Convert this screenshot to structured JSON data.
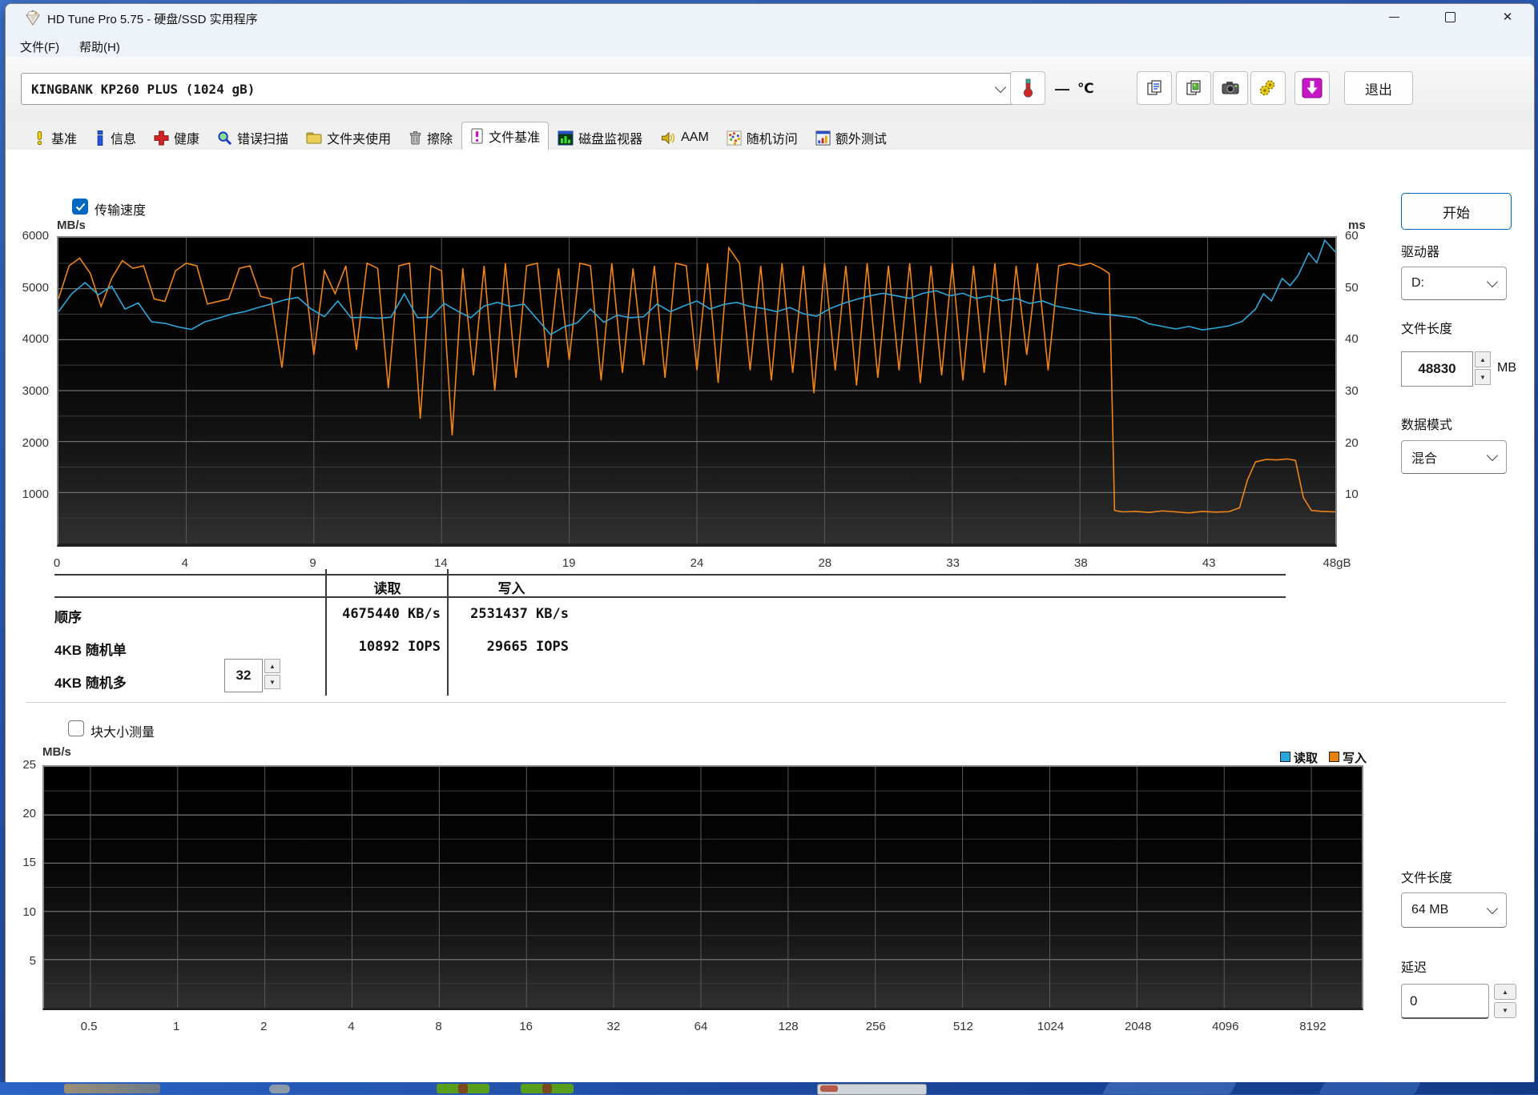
{
  "colors": {
    "accent": "#0067c0",
    "read": "#2fa8dc",
    "write": "#f08418",
    "legend_read": "#29a8e0",
    "legend_write": "#e8820c"
  },
  "window": {
    "title": "HD Tune Pro 5.75 - 硬盘/SSD 实用程序",
    "controls": {
      "close": "✕"
    }
  },
  "menu": {
    "file": "文件(F)",
    "help": "帮助(H)"
  },
  "toolbar": {
    "drive_select": "KINGBANK KP260 PLUS (1024 gB)",
    "temperature_value": "—",
    "temperature_unit": "℃",
    "exit_label": "退出"
  },
  "tabs": [
    {
      "label": "基准"
    },
    {
      "label": "信息"
    },
    {
      "label": "健康"
    },
    {
      "label": "错误扫描"
    },
    {
      "label": "文件夹使用"
    },
    {
      "label": "擦除"
    },
    {
      "label": "文件基准",
      "active": true
    },
    {
      "label": "磁盘监视器"
    },
    {
      "label": "AAM"
    },
    {
      "label": "随机访问"
    },
    {
      "label": "额外测试"
    }
  ],
  "benchmark": {
    "transfer_label": "传输速度",
    "start": "开始",
    "drive_label": "驱动器",
    "drive_value": "D:",
    "file_length_label": "文件长度",
    "file_length_value": "48830",
    "file_length_unit": "MB",
    "data_mode_label": "数据模式",
    "data_mode_value": "混合",
    "queue_depth": "32"
  },
  "results": {
    "read_header": "读取",
    "write_header": "写入",
    "rows": [
      {
        "label": "顺序",
        "read": "4675440 KB/s",
        "write": "2531437 KB/s"
      },
      {
        "label": "4KB 随机单",
        "read": "10892 IOPS",
        "write": "29665 IOPS"
      },
      {
        "label": "4KB 随机多",
        "read": "",
        "write": ""
      }
    ]
  },
  "block": {
    "checkbox_label": "块大小测量",
    "legend_read": "读取",
    "legend_write": "写入",
    "file_length_label": "文件长度",
    "file_length_value": "64 MB",
    "delay_label": "延迟",
    "delay_value": "0"
  },
  "chart_data": [
    {
      "type": "line",
      "title": "传输速度",
      "x_axis": {
        "min": 0,
        "max": 48,
        "unit": "GB",
        "tick_labels": [
          "0",
          "4",
          "9",
          "14",
          "19",
          "24",
          "28",
          "33",
          "38",
          "43",
          "48gB"
        ]
      },
      "y_axis_left": {
        "label": "MB/s",
        "min": 0,
        "max": 6000,
        "tick_labels": [
          "6000",
          "5000",
          "4000",
          "3000",
          "2000",
          "1000"
        ]
      },
      "y_axis_right": {
        "label": "ms",
        "min": 0,
        "max": 60,
        "tick_labels": [
          "60",
          "50",
          "40",
          "30",
          "20",
          "10"
        ]
      },
      "grid": {
        "h_major": 1000,
        "h_minor": 500,
        "v_at_each_tick": true
      },
      "series": [
        {
          "name": "读取",
          "color": "#2fa8dc",
          "points": [
            [
              0,
              4550
            ],
            [
              0.5,
              4900
            ],
            [
              1,
              5120
            ],
            [
              1.5,
              4880
            ],
            [
              2,
              5050
            ],
            [
              2.5,
              4600
            ],
            [
              3,
              4720
            ],
            [
              3.5,
              4350
            ],
            [
              4,
              4320
            ],
            [
              4.5,
              4250
            ],
            [
              5,
              4200
            ],
            [
              5.5,
              4350
            ],
            [
              6,
              4420
            ],
            [
              6.5,
              4500
            ],
            [
              7,
              4550
            ],
            [
              7.5,
              4630
            ],
            [
              8,
              4700
            ],
            [
              8.5,
              4780
            ],
            [
              9,
              4830
            ],
            [
              9.5,
              4600
            ],
            [
              10,
              4450
            ],
            [
              10.5,
              4760
            ],
            [
              11,
              4430
            ],
            [
              11.5,
              4440
            ],
            [
              12,
              4420
            ],
            [
              12.5,
              4440
            ],
            [
              13,
              4900
            ],
            [
              13.5,
              4430
            ],
            [
              14,
              4440
            ],
            [
              14.5,
              4710
            ],
            [
              15,
              4560
            ],
            [
              15.5,
              4430
            ],
            [
              16,
              4660
            ],
            [
              16.5,
              4730
            ],
            [
              17,
              4650
            ],
            [
              17.5,
              4700
            ],
            [
              18,
              4400
            ],
            [
              18.5,
              4100
            ],
            [
              19,
              4250
            ],
            [
              19.5,
              4330
            ],
            [
              20,
              4600
            ],
            [
              20.5,
              4340
            ],
            [
              21,
              4480
            ],
            [
              21.5,
              4430
            ],
            [
              22,
              4450
            ],
            [
              22.5,
              4700
            ],
            [
              23,
              4550
            ],
            [
              23.5,
              4660
            ],
            [
              24,
              4760
            ],
            [
              24.5,
              4600
            ],
            [
              25,
              4690
            ],
            [
              25.5,
              4730
            ],
            [
              26,
              4650
            ],
            [
              26.5,
              4610
            ],
            [
              27,
              4550
            ],
            [
              27.5,
              4630
            ],
            [
              28,
              4510
            ],
            [
              28.5,
              4460
            ],
            [
              29,
              4610
            ],
            [
              29.5,
              4710
            ],
            [
              30,
              4790
            ],
            [
              30.5,
              4860
            ],
            [
              31,
              4910
            ],
            [
              31.5,
              4860
            ],
            [
              32,
              4810
            ],
            [
              32.5,
              4910
            ],
            [
              33,
              4960
            ],
            [
              33.5,
              4860
            ],
            [
              34,
              4910
            ],
            [
              34.5,
              4810
            ],
            [
              35,
              4860
            ],
            [
              35.5,
              4760
            ],
            [
              36,
              4810
            ],
            [
              36.5,
              4710
            ],
            [
              37,
              4760
            ],
            [
              37.5,
              4660
            ],
            [
              38,
              4610
            ],
            [
              38.5,
              4560
            ],
            [
              39,
              4510
            ],
            [
              39.5,
              4490
            ],
            [
              40,
              4460
            ],
            [
              40.5,
              4430
            ],
            [
              41,
              4310
            ],
            [
              41.5,
              4260
            ],
            [
              42,
              4210
            ],
            [
              42.5,
              4260
            ],
            [
              43,
              4190
            ],
            [
              43.5,
              4230
            ],
            [
              44,
              4270
            ],
            [
              44.5,
              4360
            ],
            [
              45,
              4600
            ],
            [
              45.3,
              4900
            ],
            [
              45.6,
              4760
            ],
            [
              46,
              5200
            ],
            [
              46.3,
              5060
            ],
            [
              46.6,
              5260
            ],
            [
              47,
              5700
            ],
            [
              47.3,
              5510
            ],
            [
              47.6,
              5950
            ],
            [
              48,
              5720
            ]
          ]
        },
        {
          "name": "写入",
          "color": "#f08418",
          "points": [
            [
              0,
              4800
            ],
            [
              0.4,
              5450
            ],
            [
              0.8,
              5600
            ],
            [
              1.2,
              5300
            ],
            [
              1.6,
              4650
            ],
            [
              2,
              5200
            ],
            [
              2.4,
              5550
            ],
            [
              2.8,
              5400
            ],
            [
              3.2,
              5450
            ],
            [
              3.6,
              4800
            ],
            [
              4,
              4750
            ],
            [
              4.4,
              5350
            ],
            [
              4.8,
              5500
            ],
            [
              5.2,
              5450
            ],
            [
              5.6,
              4700
            ],
            [
              6,
              4750
            ],
            [
              6.4,
              4800
            ],
            [
              6.8,
              5400
            ],
            [
              7.2,
              5450
            ],
            [
              7.6,
              4850
            ],
            [
              8,
              4800
            ],
            [
              8.4,
              3450
            ],
            [
              8.8,
              5400
            ],
            [
              9.2,
              5500
            ],
            [
              9.6,
              3700
            ],
            [
              10,
              5350
            ],
            [
              10.4,
              4900
            ],
            [
              10.8,
              5450
            ],
            [
              11.2,
              3800
            ],
            [
              11.6,
              5500
            ],
            [
              12,
              5400
            ],
            [
              12.4,
              3050
            ],
            [
              12.8,
              5450
            ],
            [
              13.2,
              5500
            ],
            [
              13.6,
              2450
            ],
            [
              14,
              5450
            ],
            [
              14.4,
              5350
            ],
            [
              14.8,
              2120
            ],
            [
              15.2,
              5400
            ],
            [
              15.6,
              3300
            ],
            [
              16,
              5450
            ],
            [
              16.4,
              3000
            ],
            [
              16.8,
              5500
            ],
            [
              17.2,
              3250
            ],
            [
              17.6,
              5450
            ],
            [
              18,
              5500
            ],
            [
              18.4,
              3450
            ],
            [
              18.8,
              5400
            ],
            [
              19.2,
              3600
            ],
            [
              19.6,
              5500
            ],
            [
              20,
              5450
            ],
            [
              20.4,
              3200
            ],
            [
              20.8,
              5500
            ],
            [
              21.2,
              3350
            ],
            [
              21.6,
              5400
            ],
            [
              22,
              3500
            ],
            [
              22.4,
              5450
            ],
            [
              22.8,
              3250
            ],
            [
              23.2,
              5500
            ],
            [
              23.6,
              5450
            ],
            [
              24,
              3400
            ],
            [
              24.4,
              5500
            ],
            [
              24.8,
              3150
            ],
            [
              25.2,
              5800
            ],
            [
              25.6,
              5500
            ],
            [
              26,
              3400
            ],
            [
              26.4,
              5450
            ],
            [
              26.8,
              3200
            ],
            [
              27.2,
              5500
            ],
            [
              27.6,
              3350
            ],
            [
              28,
              5450
            ],
            [
              28.4,
              2950
            ],
            [
              28.8,
              5500
            ],
            [
              29.2,
              3400
            ],
            [
              29.6,
              5450
            ],
            [
              30,
              3100
            ],
            [
              30.4,
              5500
            ],
            [
              30.8,
              3250
            ],
            [
              31.2,
              5450
            ],
            [
              31.6,
              3400
            ],
            [
              32,
              5500
            ],
            [
              32.4,
              3150
            ],
            [
              32.8,
              5450
            ],
            [
              33.2,
              3300
            ],
            [
              33.6,
              5500
            ],
            [
              34,
              3200
            ],
            [
              34.4,
              5450
            ],
            [
              34.8,
              3350
            ],
            [
              35.2,
              5500
            ],
            [
              35.6,
              3100
            ],
            [
              36,
              5450
            ],
            [
              36.4,
              3700
            ],
            [
              36.8,
              5500
            ],
            [
              37.2,
              3400
            ],
            [
              37.6,
              5450
            ],
            [
              38,
              5500
            ],
            [
              38.4,
              5450
            ],
            [
              38.8,
              5500
            ],
            [
              39.2,
              5400
            ],
            [
              39.5,
              5300
            ],
            [
              39.7,
              650
            ],
            [
              40,
              620
            ],
            [
              40.5,
              630
            ],
            [
              41,
              610
            ],
            [
              41.5,
              640
            ],
            [
              42,
              620
            ],
            [
              42.5,
              600
            ],
            [
              43,
              630
            ],
            [
              43.5,
              615
            ],
            [
              44,
              625
            ],
            [
              44.4,
              700
            ],
            [
              44.7,
              1250
            ],
            [
              45,
              1600
            ],
            [
              45.4,
              1650
            ],
            [
              45.8,
              1640
            ],
            [
              46.2,
              1660
            ],
            [
              46.5,
              1630
            ],
            [
              46.8,
              900
            ],
            [
              47.1,
              650
            ],
            [
              47.5,
              630
            ],
            [
              48,
              620
            ]
          ]
        }
      ]
    },
    {
      "type": "line",
      "title": "块大小测量",
      "x_axis": {
        "scale": "log2",
        "tick_labels": [
          "0.5",
          "1",
          "2",
          "4",
          "8",
          "16",
          "32",
          "64",
          "128",
          "256",
          "512",
          "1024",
          "2048",
          "4096",
          "8192"
        ]
      },
      "y_axis": {
        "label": "MB/s",
        "min": 0,
        "max": 25,
        "tick_labels": [
          "25",
          "20",
          "15",
          "10",
          "5"
        ]
      },
      "grid": {
        "h_major": 5,
        "h_minor": 2.5,
        "v_at_each_tick": true
      },
      "series": [
        {
          "name": "读取",
          "color": "#2fa8dc",
          "points": []
        },
        {
          "name": "写入",
          "color": "#f08418",
          "points": []
        }
      ]
    }
  ]
}
